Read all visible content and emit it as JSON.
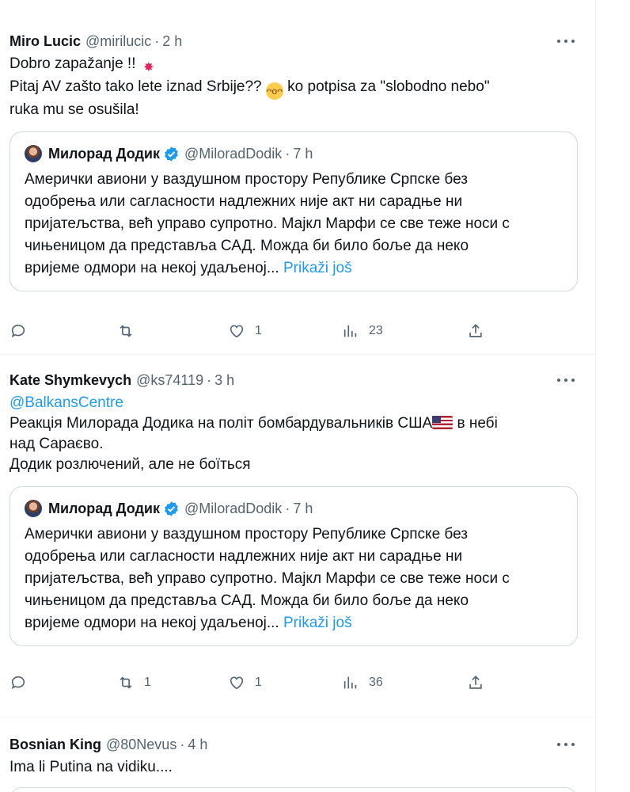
{
  "tweets": [
    {
      "name": "Miro Lucic",
      "handle": "@mirilucic",
      "dot": "·",
      "time": "2 h",
      "text": {
        "l1a": "Dobro zapažanje !! ",
        "l2a": "Pitaj AV zašto tako lete iznad Srbije?? ",
        "l2b": " ko potpisa  za \"slobodno nebo\"",
        "l3": "ruka mu se osušila!"
      },
      "quote": {
        "name": "Милорад Додик",
        "handle": "@MiloradDodik",
        "dot": "·",
        "time": "7 h",
        "lines": [
          "Амерички авиони у ваздушном простору Републике Српске без",
          "одобрења или сагласности надлежних није акт ни сарадње ни",
          "пријатељства, већ управо супротно. Мајкл Марфи се све теже носи с",
          "чињеницом да представља САД. Можда би било боље да неко"
        ],
        "last_line": "вријеме одмори на некој удаљеној... ",
        "show_more": "Prikaži još"
      },
      "actions": {
        "replies": "",
        "reposts": "",
        "likes": "1",
        "views": "23"
      }
    },
    {
      "name": "Kate Shymkevych",
      "handle": "@ks74119",
      "dot": "·",
      "time": "3 h",
      "text": {
        "mention": "@BalkansCentre",
        "l2a": "Реакція Милорада Додика на політ бомбардувальників США",
        "l2b": " в небі",
        "l3": "над Сараєво.",
        "l4": "Додик розлючений, але не боїться"
      },
      "quote": {
        "name": "Милорад Додик",
        "handle": "@MiloradDodik",
        "dot": "·",
        "time": "7 h",
        "lines": [
          "Амерички авиони у ваздушном простору Републике Српске без",
          "одобрења или сагласности надлежних није акт ни сарадње ни",
          "пријатељства, већ управо супротно. Мајкл Марфи се све теже носи с",
          "чињеницом да представља САД. Можда би било боље да неко"
        ],
        "last_line": "вријеме одмори на некој удаљеној... ",
        "show_more": "Prikaži još"
      },
      "actions": {
        "replies": "",
        "reposts": "1",
        "likes": "1",
        "views": "36"
      }
    },
    {
      "name": "Bosnian King",
      "handle": "@80Nevus",
      "dot": "·",
      "time": "4 h",
      "text": {
        "l1": "Ima li Putina na vidiku...."
      }
    }
  ],
  "icons": {
    "more": "more-dots-icon",
    "reply": "reply-icon",
    "repost": "repost-icon",
    "like": "heart-icon",
    "views": "views-icon",
    "share": "share-icon",
    "verified": "verified-badge-icon"
  },
  "colors": {
    "link": "#1d9bf0",
    "muted": "#536471",
    "border": "#cfd9de",
    "verified": "#1d9bf0"
  }
}
